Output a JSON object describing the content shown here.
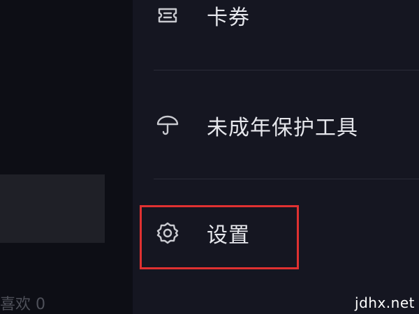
{
  "background_app": {
    "likes_text": "喜欢 0"
  },
  "menu": {
    "items": [
      {
        "label": "卡券",
        "icon": "ticket-icon"
      },
      {
        "label": "未成年保护工具",
        "icon": "umbrella-icon"
      },
      {
        "label": "设置",
        "icon": "gear-icon"
      }
    ]
  },
  "highlight": {
    "target": "设置",
    "color": "#e03131"
  },
  "watermark": "jdhx.net",
  "colors": {
    "drawer_background": "#151621",
    "text": "#e6e7ec",
    "icon": "#c9cad0",
    "highlight": "#e03131"
  }
}
